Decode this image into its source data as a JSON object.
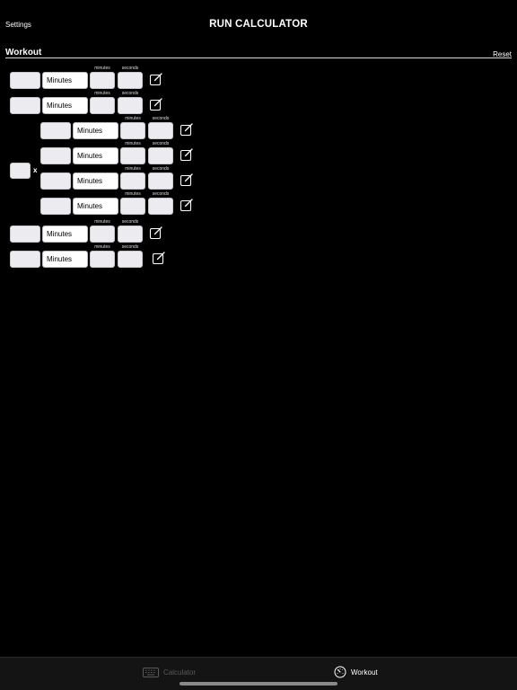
{
  "header": {
    "settings_label": "Settings",
    "title": "RUN CALCULATOR"
  },
  "section": {
    "title": "Workout",
    "reset_label": "Reset"
  },
  "rows": [
    {
      "unit": "Minutes",
      "minutes_caption": "minutes",
      "seconds_caption": "seconds"
    },
    {
      "unit": "Minutes",
      "minutes_caption": "minutes",
      "seconds_caption": "seconds"
    },
    {
      "unit": "Minutes",
      "minutes_caption": "minutes",
      "seconds_caption": "seconds"
    },
    {
      "unit": "Minutes",
      "minutes_caption": "minutes",
      "seconds_caption": "seconds"
    },
    {
      "unit": "Minutes",
      "minutes_caption": "minutes",
      "seconds_caption": "seconds"
    },
    {
      "unit": "Minutes",
      "minutes_caption": "minutes",
      "seconds_caption": "seconds"
    },
    {
      "unit": "Minutes",
      "minutes_caption": "minutes",
      "seconds_caption": "seconds"
    },
    {
      "unit": "Minutes",
      "minutes_caption": "minutes",
      "seconds_caption": "seconds"
    }
  ],
  "repeat": {
    "multiplier_symbol": "x"
  },
  "tabs": [
    {
      "label": "Calculator",
      "icon": "keyboard-icon",
      "active": false
    },
    {
      "label": "Workout",
      "icon": "speedometer-icon",
      "active": true
    }
  ],
  "colors": {
    "background": "#000000",
    "field": "#ececf0",
    "inactive_tab": "#5a5a5a"
  }
}
